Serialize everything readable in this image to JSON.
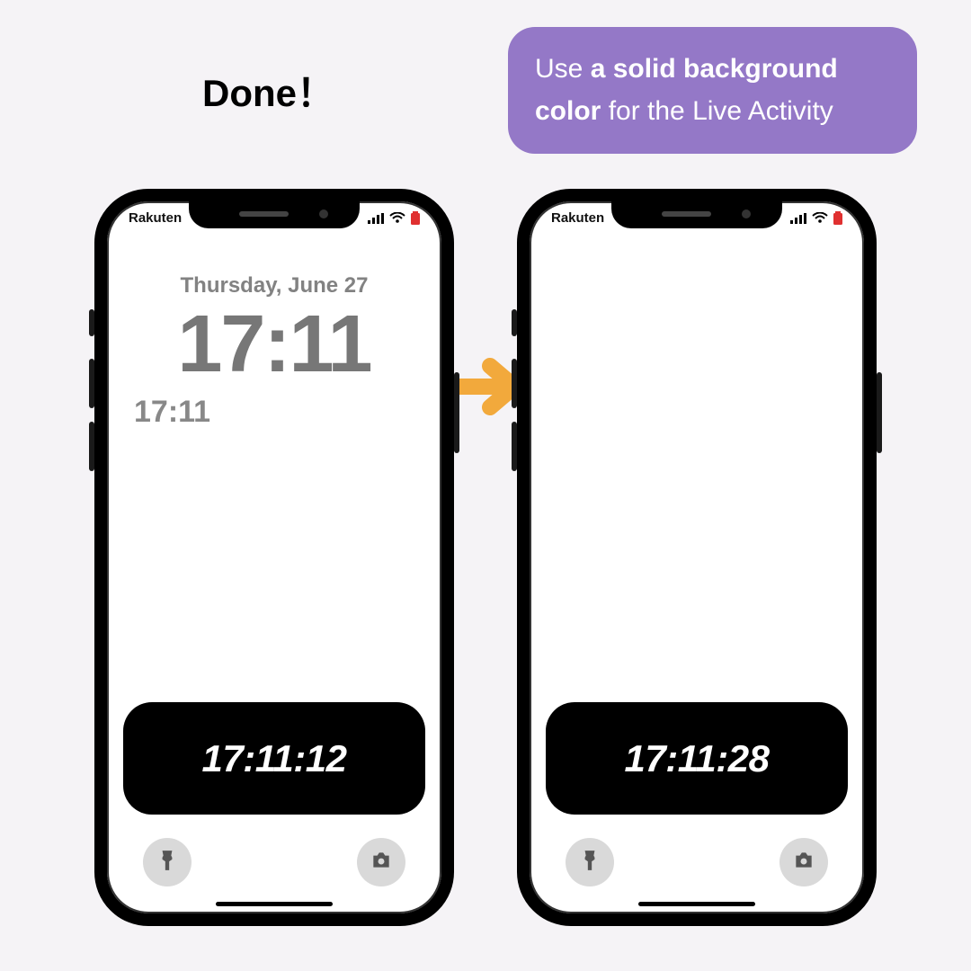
{
  "heading": {
    "done": "Done！"
  },
  "tip": {
    "pre": "Use ",
    "bold": "a solid background color",
    "post": " for the Live Activity"
  },
  "phoneLeft": {
    "carrier": "Rakuten",
    "date": "Thursday, June 27",
    "bigtime": "17:11",
    "smalltime": "17:11",
    "live": "17:11:12"
  },
  "phoneRight": {
    "carrier": "Rakuten",
    "live": "17:11:28"
  },
  "colors": {
    "tipBg": "#9478c7",
    "arrow": "#f2a93c",
    "battLow": "#e03030"
  }
}
